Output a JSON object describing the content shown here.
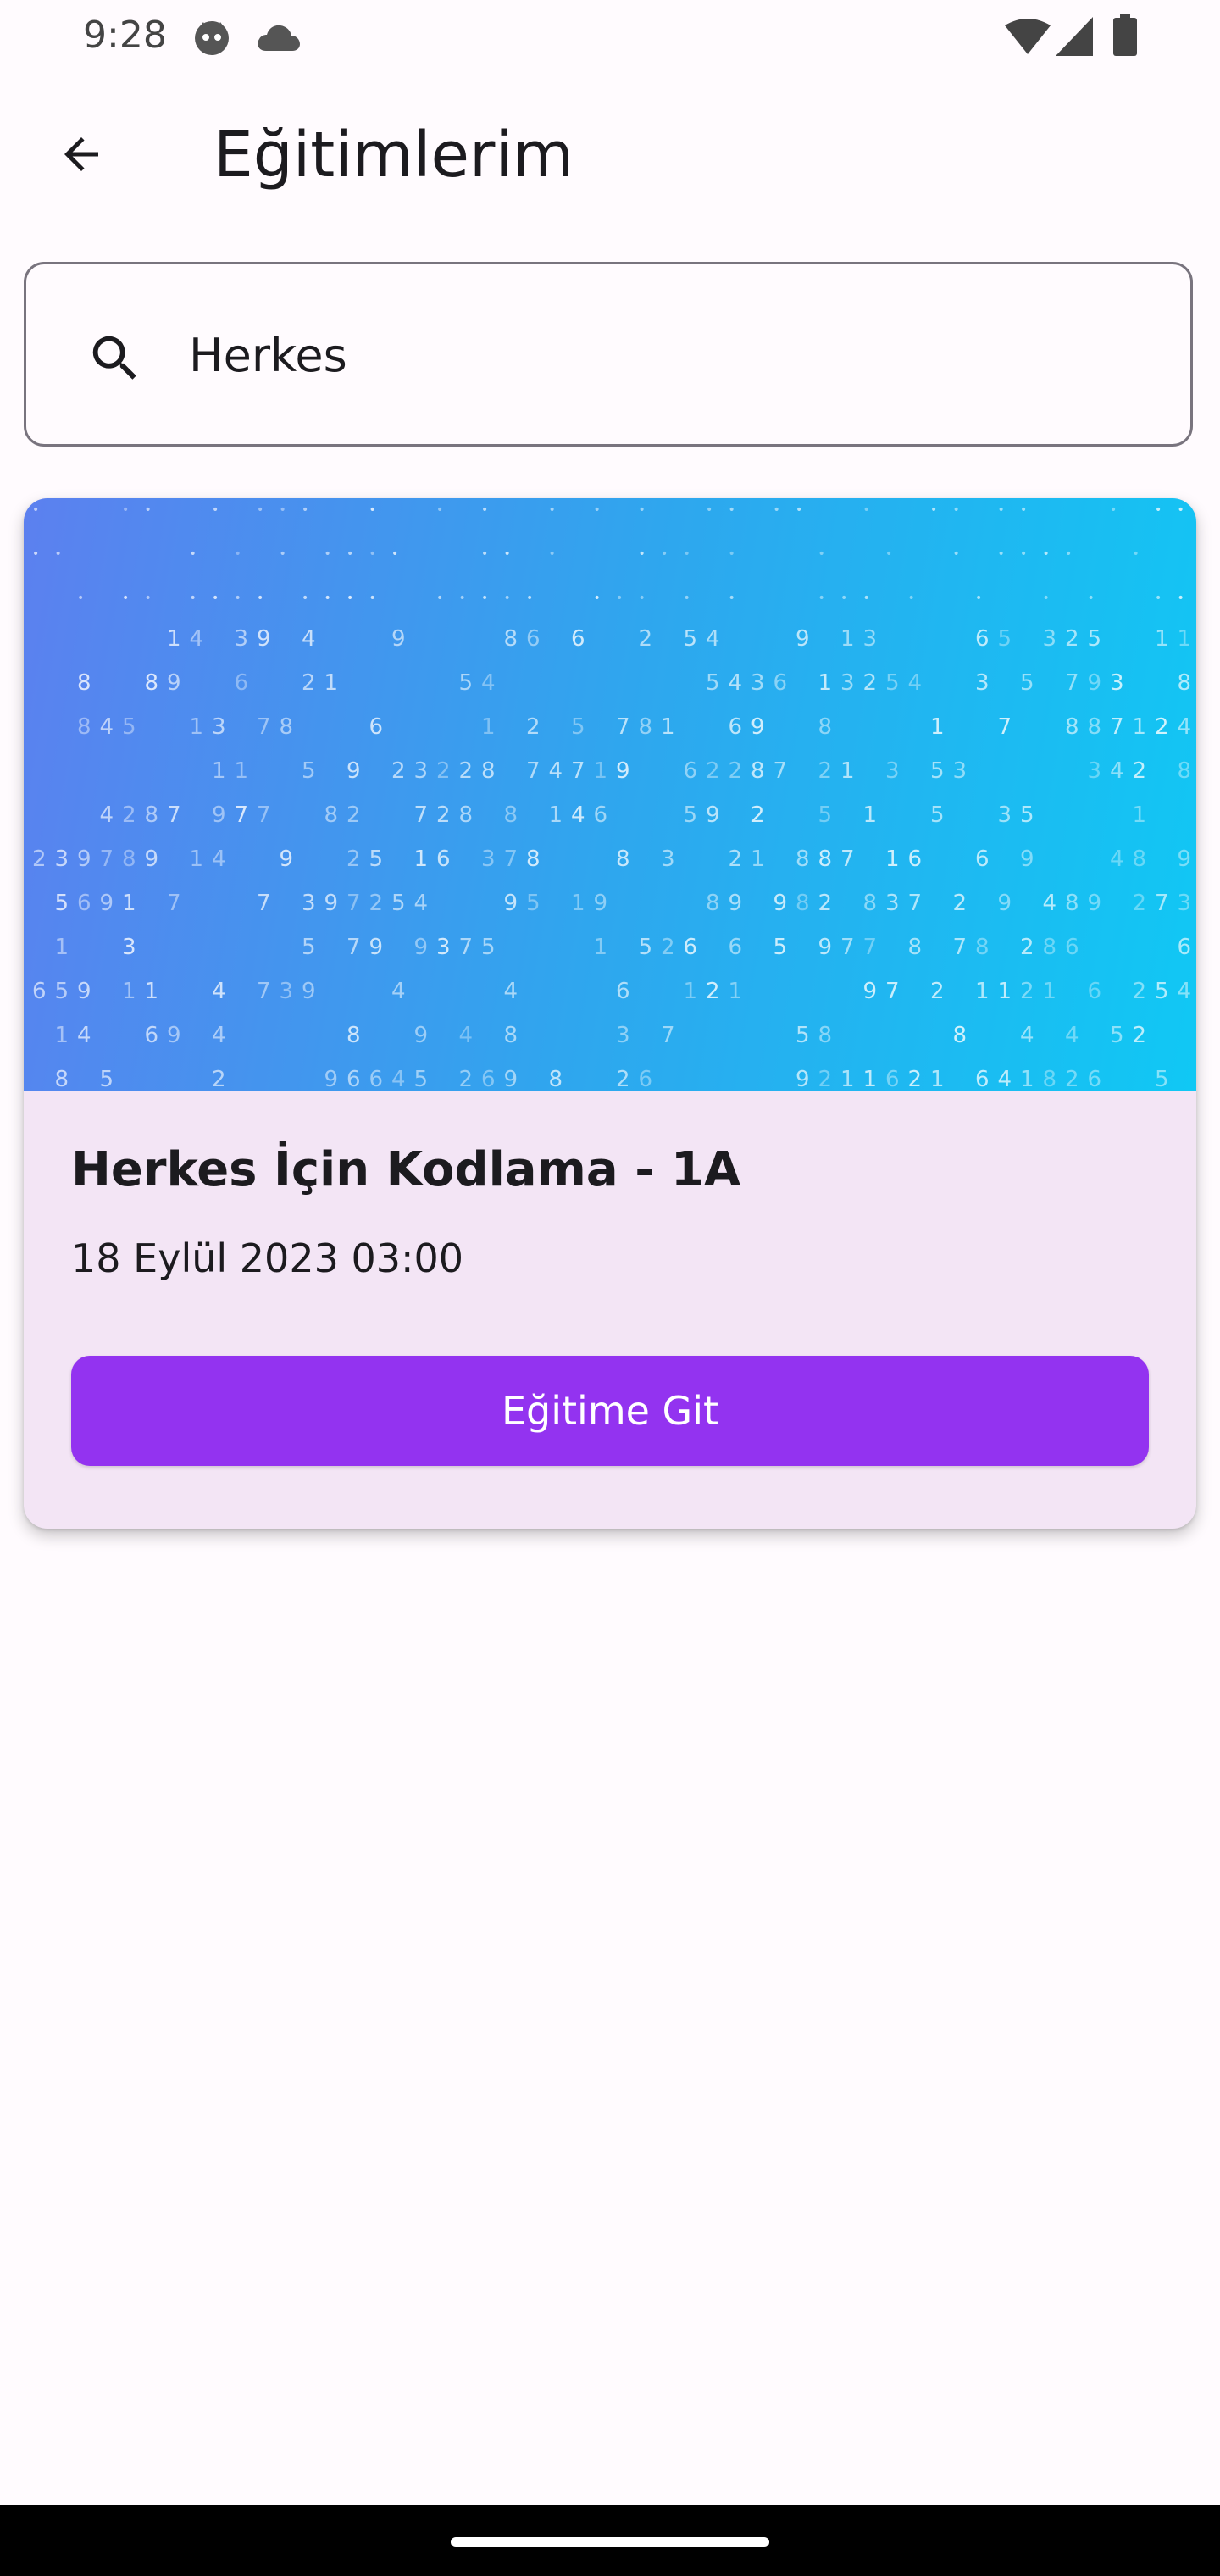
{
  "status_bar": {
    "time": "9:28",
    "icons": [
      "face-icon",
      "cloud-icon",
      "wifi-icon",
      "signal-icon",
      "battery-icon"
    ]
  },
  "app_bar": {
    "back_icon": "arrow-back-icon",
    "title": "Eğitimlerim"
  },
  "search": {
    "icon": "search-icon",
    "value": "Herkes",
    "placeholder": ""
  },
  "courses": [
    {
      "title": "Herkes İçin Kodlama - 1A",
      "date": "18 Eylül 2023 03:00",
      "button_label": "Eğitime Git"
    }
  ],
  "colors": {
    "background": "#fffbfe",
    "card_background": "#f3e5f5",
    "accent": "#9333f0",
    "image_gradient_start": "#5c80ef",
    "image_gradient_end": "#10c8f4"
  }
}
